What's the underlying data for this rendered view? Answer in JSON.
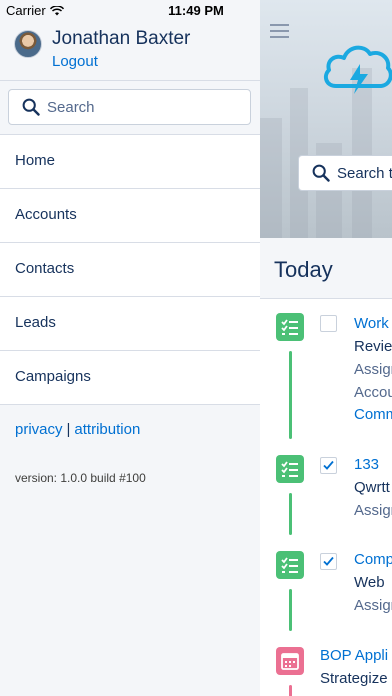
{
  "status_bar": {
    "carrier": "Carrier",
    "time": "11:49 PM"
  },
  "sidebar": {
    "user_name": "Jonathan Baxter",
    "logout_label": "Logout",
    "search_placeholder": "Search",
    "nav_items": [
      "Home",
      "Accounts",
      "Contacts",
      "Leads",
      "Campaigns"
    ],
    "privacy_label": "privacy",
    "separator": "|",
    "attribution_label": "attribution",
    "version": "version: 1.0.0 build #100"
  },
  "main": {
    "search_text": "Search t",
    "today_label": "Today",
    "feed": [
      {
        "checked": false,
        "lines": [
          "Work",
          "Revie",
          "Assign",
          "Accou",
          "Comm"
        ]
      },
      {
        "checked": true,
        "lines": [
          "133",
          "Qwrtt",
          "Assign"
        ]
      },
      {
        "checked": true,
        "lines": [
          "Comp",
          "Web",
          "Assign"
        ]
      },
      {
        "lines": [
          "BOP Appli",
          "Strategize"
        ]
      }
    ]
  },
  "colors": {
    "link": "#0070d2",
    "text": "#16325c",
    "task": "#4bc076",
    "event": "#eb7092"
  }
}
